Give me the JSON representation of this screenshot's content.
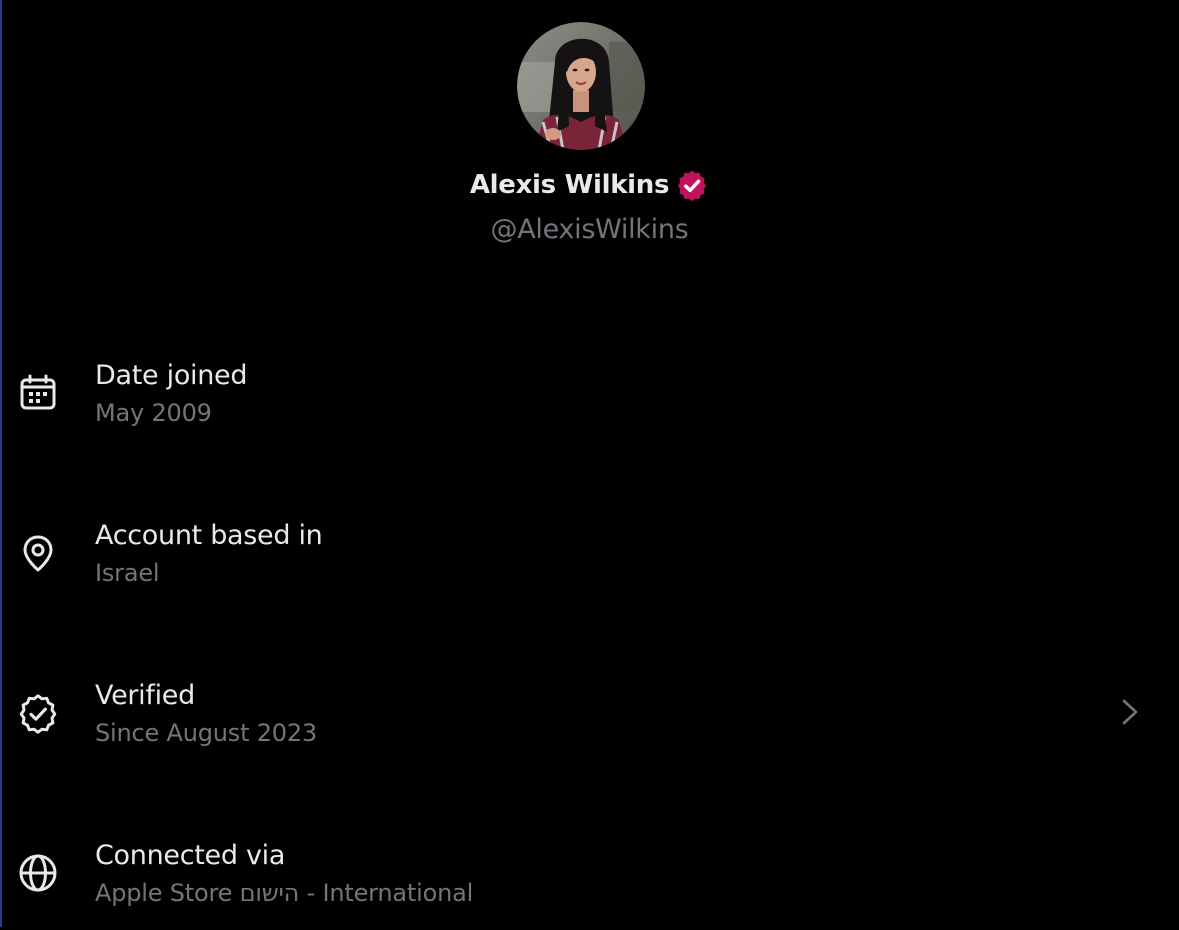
{
  "profile": {
    "display_name": "Alexis Wilkins",
    "handle": "@AlexisWilkins",
    "avatar": "profile-photo",
    "verified_badge_color": "#c0135d"
  },
  "info_rows": [
    {
      "icon": "calendar-icon",
      "title": "Date joined",
      "subtitle": "May 2009"
    },
    {
      "icon": "location-pin-icon",
      "title": "Account based in",
      "subtitle": "Israel"
    },
    {
      "icon": "verified-badge-icon",
      "title": "Verified",
      "subtitle": "Since August 2023",
      "chevron": "chevron-right-icon"
    },
    {
      "icon": "globe-icon",
      "title": "Connected via",
      "subtitle": "Apple Store הישום - International"
    }
  ],
  "colors": {
    "background": "#000000",
    "primary_text": "#e7e9ea",
    "secondary_text": "#71767b"
  }
}
